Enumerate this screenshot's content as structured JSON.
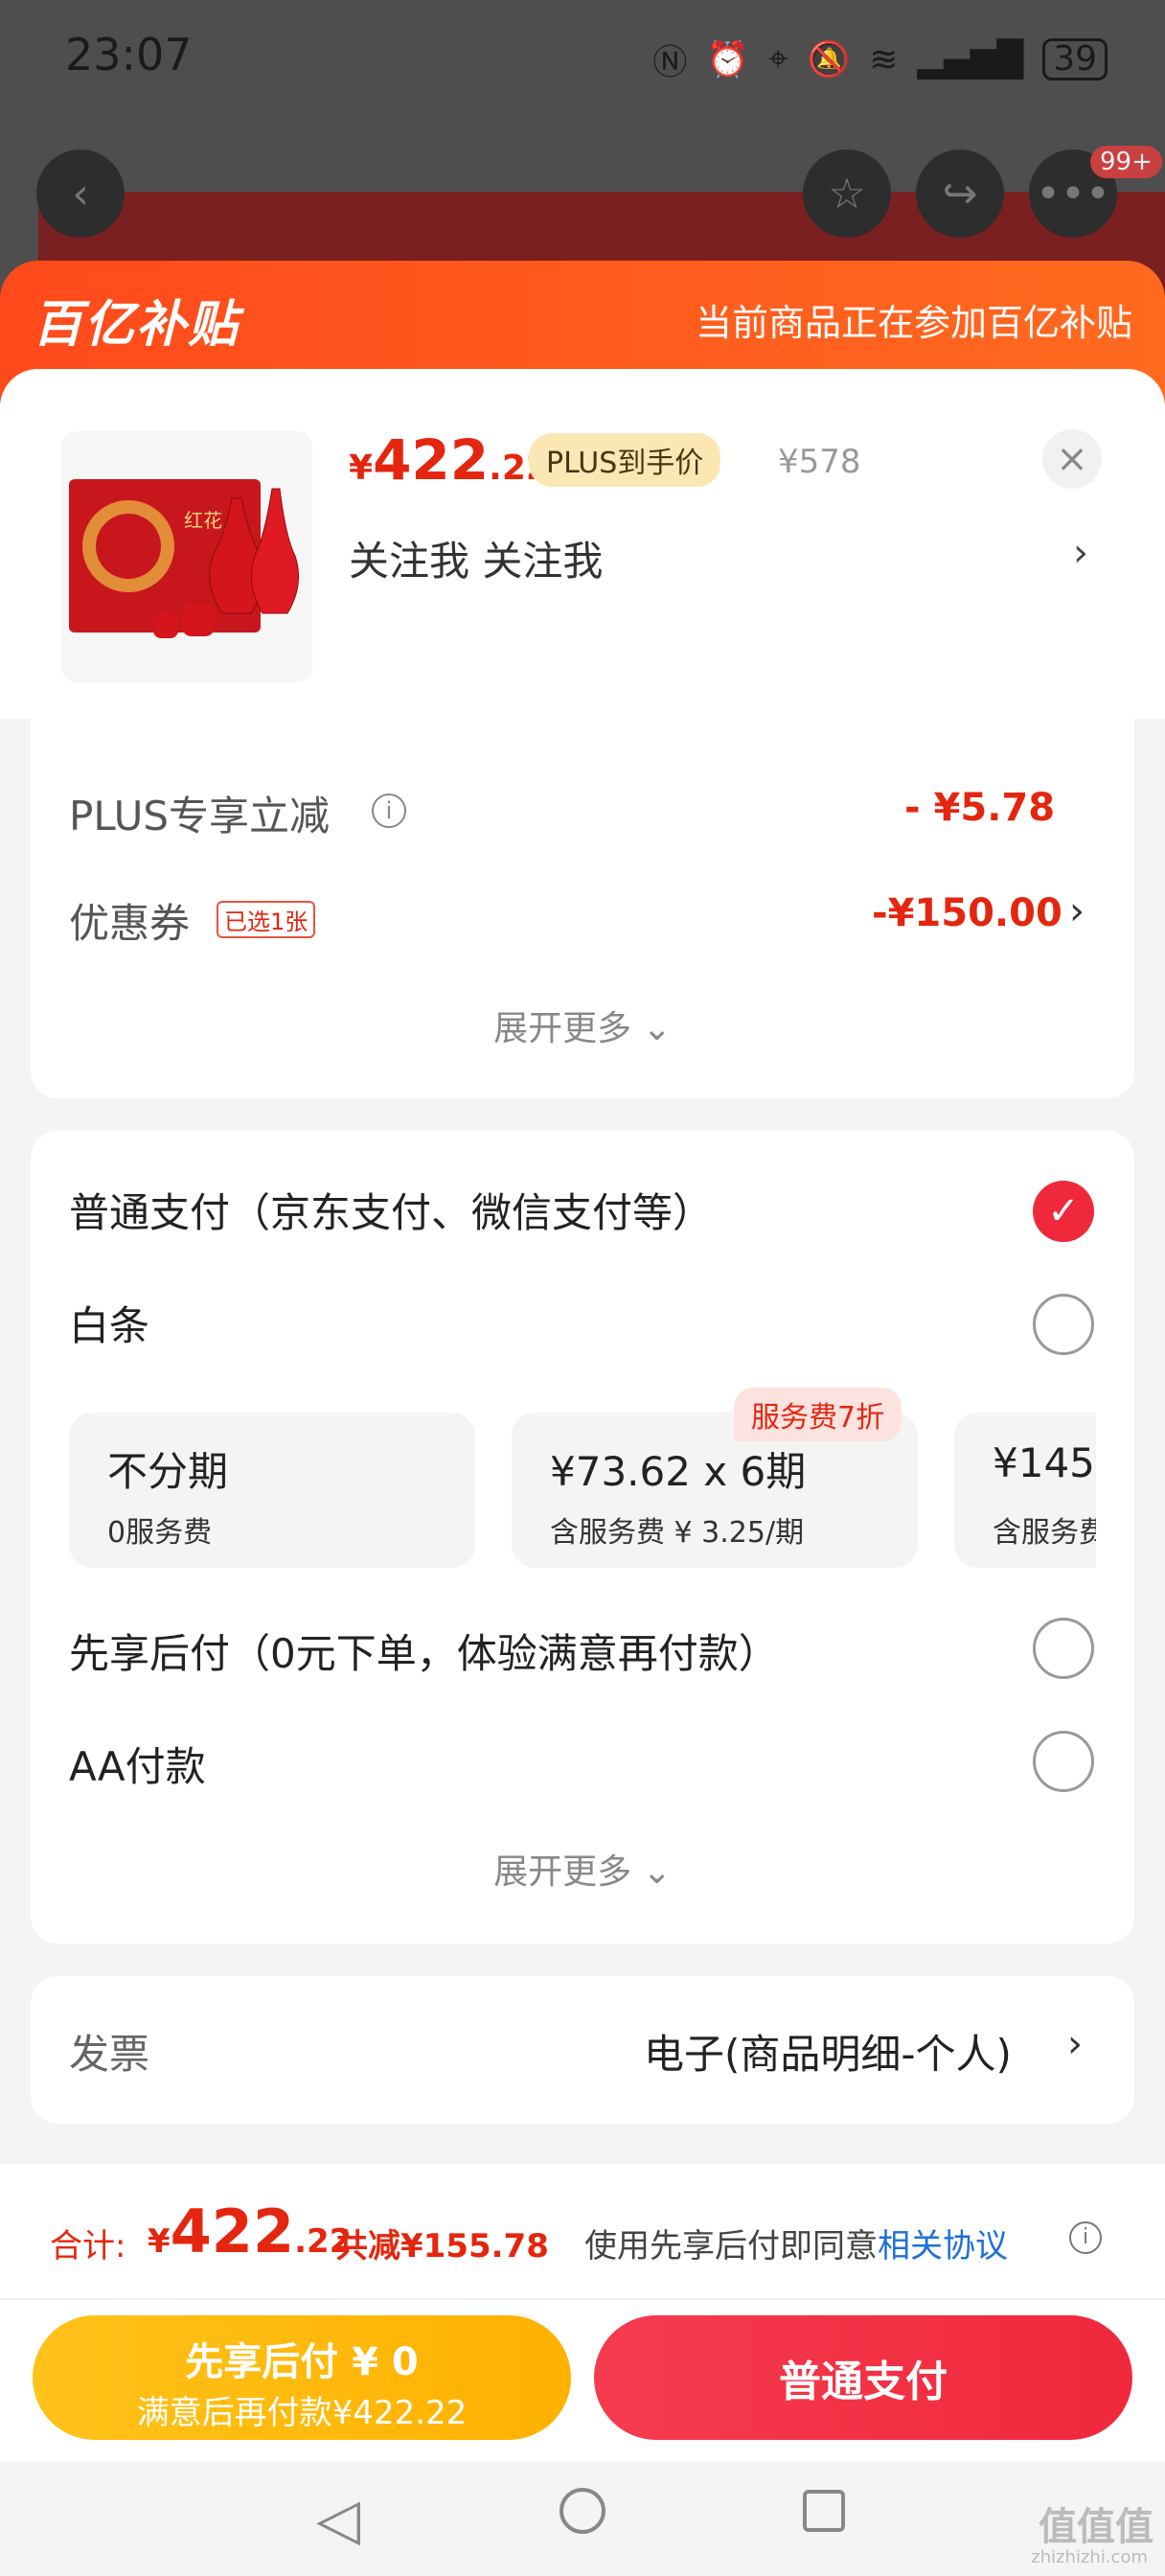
{
  "status_bar": {
    "time": "23:07",
    "battery": "39",
    "icons": [
      "nfc-icon",
      "alarm-icon",
      "location-icon",
      "mute-icon",
      "wifi-icon",
      "signal-icon"
    ]
  },
  "top_actions": {
    "badge": "99+"
  },
  "banner": {
    "logo": "百亿补贴",
    "text": "当前商品正在参加百亿补贴"
  },
  "product": {
    "price_symbol": "¥",
    "price_int": "422",
    "price_dec": ".22",
    "plus_tag": "PLUS到手价",
    "original_price": "¥578",
    "follow_text": "关注我  关注我",
    "close": "×"
  },
  "discounts": {
    "plus_label": "PLUS专享立减",
    "plus_value": "- ¥5.78",
    "coupon_label": "优惠券",
    "coupon_tag": "已选1张",
    "coupon_value": "-¥150.00",
    "more": "展开更多"
  },
  "payment": {
    "normal_label": "普通支付（京东支付、微信支付等）",
    "baitiao_label": "白条",
    "installments": [
      {
        "title": "不分期",
        "sub": "0服务费"
      },
      {
        "title": "¥73.62 x 6期",
        "sub": "含服务费 ¥ 3.25/期"
      },
      {
        "title": "¥145.",
        "sub": "含服务费"
      }
    ],
    "service_tag": "服务费7折",
    "later_label": "先享后付（0元下单，体验满意再付款）",
    "aa_label": "AA付款",
    "more": "展开更多"
  },
  "invoice": {
    "label": "发票",
    "value": "电子(商品明细-个人)"
  },
  "footer": {
    "total_label": "合计:",
    "total_symbol": "¥",
    "total_int": "422",
    "total_dec": ".22",
    "saved": "共减¥155.78",
    "agree_text": "使用先享后付即同意",
    "agree_link": "相关协议",
    "btn_later_line1": "先享后付 ¥ 0",
    "btn_later_line2": "满意后再付款¥422.22",
    "btn_normal": "普通支付"
  },
  "watermark": {
    "main": "值值值",
    "sub": "zhizhizhi.com"
  },
  "colors": {
    "accent_red": "#e4260f",
    "button_red": "#f0283c",
    "button_yellow": "#ffb100",
    "banner_orange": "#ff4a1c"
  }
}
